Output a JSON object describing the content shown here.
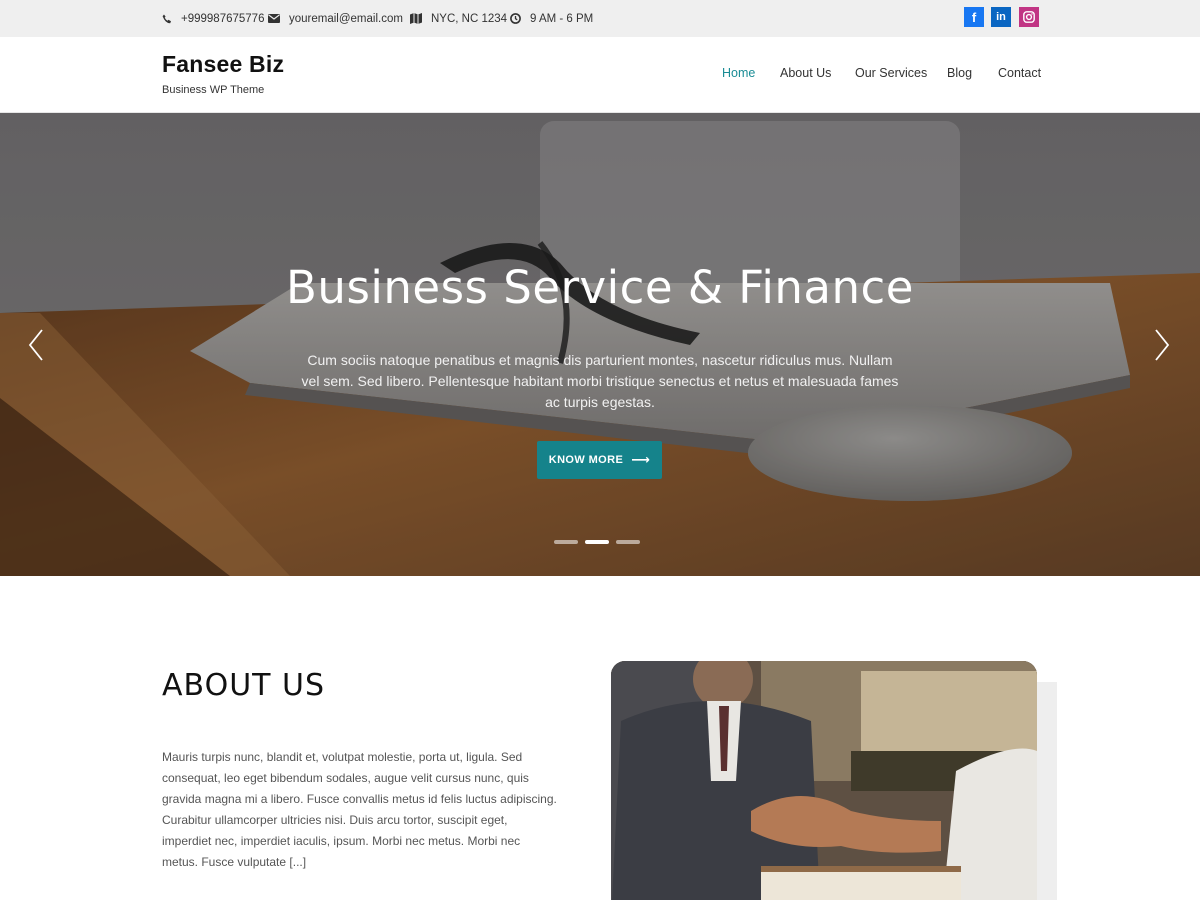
{
  "topbar": {
    "phone": "+999987675776",
    "email": "youremail@email.com",
    "location": "NYC, NC 1234",
    "hours": "9 AM - 6 PM",
    "social": [
      {
        "name": "facebook",
        "icon": "facebook-icon",
        "glyph": "f",
        "color": "#1877f2"
      },
      {
        "name": "linkedin",
        "icon": "linkedin-icon",
        "glyph": "in",
        "color": "#0a66c2"
      },
      {
        "name": "instagram",
        "icon": "instagram-icon",
        "glyph": "",
        "color": "#c13584"
      }
    ]
  },
  "header": {
    "site_title": "Fansee Biz",
    "tagline": "Business WP Theme",
    "nav": [
      {
        "label": "Home",
        "active": true
      },
      {
        "label": "About Us",
        "active": false
      },
      {
        "label": "Our Services",
        "active": false
      },
      {
        "label": "Blog",
        "active": false
      },
      {
        "label": "Contact",
        "active": false
      }
    ]
  },
  "hero": {
    "title": "Business Service & Finance",
    "text": "Cum sociis natoque penatibus et magnis dis parturient montes, nascetur ridiculus mus. Nullam vel sem. Sed libero. Pellentesque habitant morbi tristique senectus et netus et malesuada fames ac turpis egestas.",
    "button_label": "KNOW MORE",
    "slides": 3,
    "active_slide": 2,
    "accent": "#15838b"
  },
  "about": {
    "title": "ABOUT US",
    "text": "Mauris turpis nunc, blandit et, volutpat molestie, porta ut, ligula. Sed consequat, leo eget bibendum sodales, augue velit cursus nunc, quis gravida magna mi a libero. Fusce convallis metus id felis luctus adipiscing. Curabitur ullamcorper ultricies nisi. Duis arcu tortor, suscipit eget, imperdiet nec, imperdiet iaculis, ipsum. Morbi nec metus. Morbi nec metus. Fusce vulputate [...]"
  }
}
